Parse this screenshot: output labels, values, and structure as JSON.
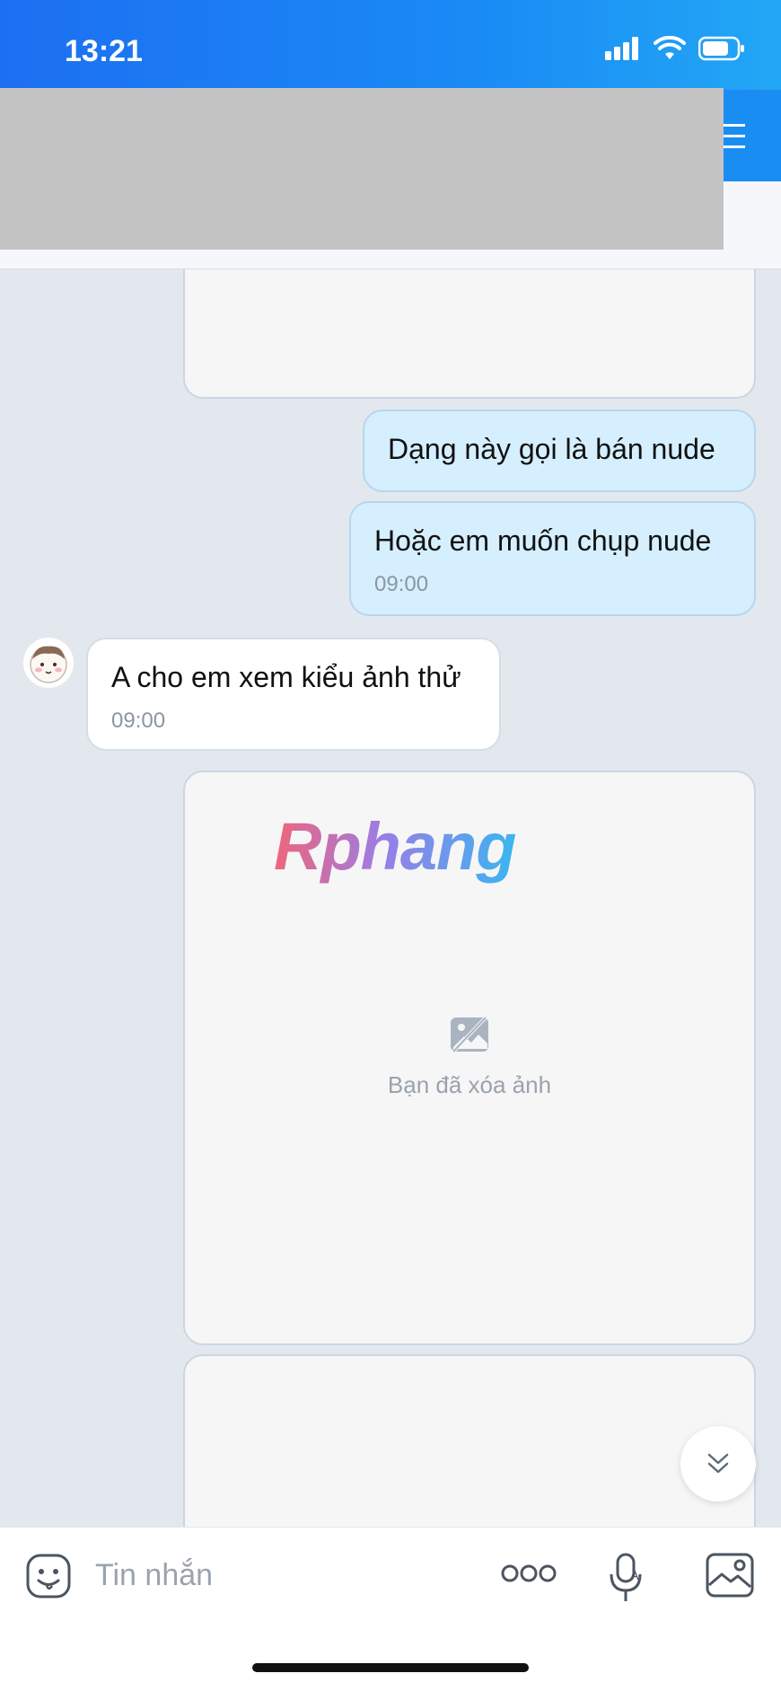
{
  "status_bar": {
    "time": "13:21"
  },
  "messages": [
    {
      "id": "m1",
      "type": "sent",
      "text": "Dạng này gọi là bán nude"
    },
    {
      "id": "m2",
      "type": "sent",
      "text": "Hoặc em muốn chụp nude",
      "time": "09:00"
    },
    {
      "id": "m3",
      "type": "received",
      "text": "A cho em xem kiểu ảnh thử",
      "time": "09:00"
    }
  ],
  "deleted_image": {
    "label": "Bạn đã xóa ảnh"
  },
  "watermark": "Rphang",
  "composer": {
    "placeholder": "Tin nhắn",
    "more_label": "ooo"
  },
  "icons": {
    "signal": "signal-icon",
    "wifi": "wifi-icon",
    "battery": "battery-icon",
    "menu": "menu-icon",
    "emoji": "emoji-icon",
    "mic": "mic-icon",
    "photo": "photo-icon",
    "scroll_down": "chevron-double-down-icon",
    "deleted_photo": "image-off-icon"
  },
  "colors": {
    "header": "#1a8df3",
    "sent_bubble": "#d5efff",
    "received_bubble": "#ffffff",
    "chat_bg": "#e3e8ef"
  }
}
